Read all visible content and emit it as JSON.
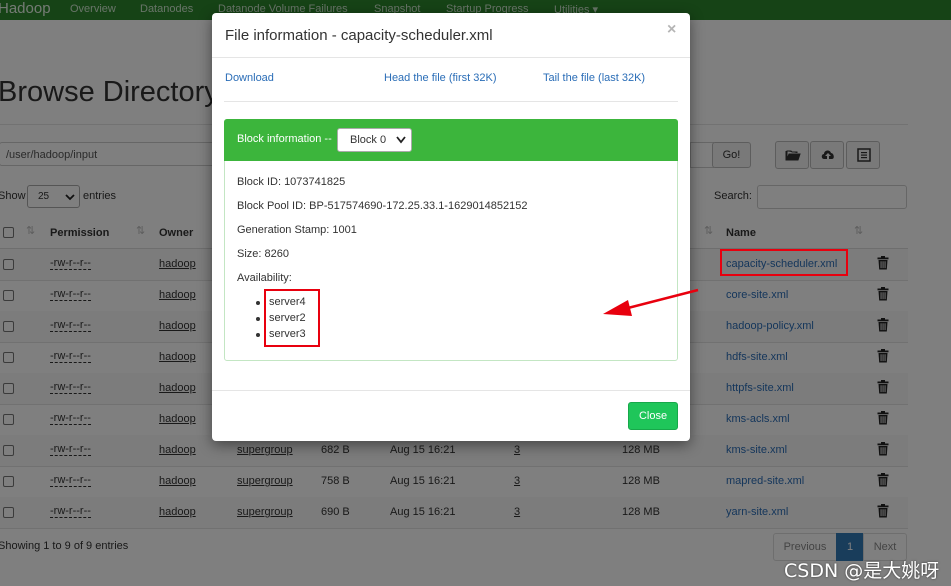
{
  "navbar": {
    "brand": "Hadoop",
    "items": [
      "Overview",
      "Datanodes",
      "Datanode Volume Failures",
      "Snapshot",
      "Startup Progress",
      "Utilities"
    ]
  },
  "page": {
    "title": "Browse Directory",
    "path_value": "/user/hadoop/input",
    "go_label": "Go!",
    "show_label": "Show",
    "entries_value": "25",
    "entries_label": "entries",
    "search_label": "Search:"
  },
  "table": {
    "headers": {
      "permission": "Permission",
      "owner": "Owner",
      "name": "Name"
    },
    "rows": [
      {
        "permission": "-rw-r--r--",
        "owner": "hadoop",
        "group": "",
        "size": "",
        "modified": "",
        "replication": "",
        "block_size": "",
        "name": "capacity-scheduler.xml"
      },
      {
        "permission": "-rw-r--r--",
        "owner": "hadoop",
        "group": "",
        "size": "",
        "modified": "",
        "replication": "",
        "block_size": "",
        "name": "core-site.xml"
      },
      {
        "permission": "-rw-r--r--",
        "owner": "hadoop",
        "group": "",
        "size": "",
        "modified": "",
        "replication": "",
        "block_size": "",
        "name": "hadoop-policy.xml"
      },
      {
        "permission": "-rw-r--r--",
        "owner": "hadoop",
        "group": "",
        "size": "",
        "modified": "",
        "replication": "",
        "block_size": "",
        "name": "hdfs-site.xml"
      },
      {
        "permission": "-rw-r--r--",
        "owner": "hadoop",
        "group": "",
        "size": "",
        "modified": "",
        "replication": "",
        "block_size": "",
        "name": "httpfs-site.xml"
      },
      {
        "permission": "-rw-r--r--",
        "owner": "hadoop",
        "group": "",
        "size": "",
        "modified": "",
        "replication": "",
        "block_size": "",
        "name": "kms-acls.xml"
      },
      {
        "permission": "-rw-r--r--",
        "owner": "hadoop",
        "group": "supergroup",
        "size": "682 B",
        "modified": "Aug 15 16:21",
        "replication": "3",
        "block_size": "128 MB",
        "name": "kms-site.xml"
      },
      {
        "permission": "-rw-r--r--",
        "owner": "hadoop",
        "group": "supergroup",
        "size": "758 B",
        "modified": "Aug 15 16:21",
        "replication": "3",
        "block_size": "128 MB",
        "name": "mapred-site.xml"
      },
      {
        "permission": "-rw-r--r--",
        "owner": "hadoop",
        "group": "supergroup",
        "size": "690 B",
        "modified": "Aug 15 16:21",
        "replication": "3",
        "block_size": "128 MB",
        "name": "yarn-site.xml"
      }
    ]
  },
  "footer": {
    "summary": "Showing 1 to 9 of 9 entries",
    "prev": "Previous",
    "current_page": "1",
    "next": "Next"
  },
  "modal": {
    "title": "File information - capacity-scheduler.xml",
    "close_glyph": "×",
    "links": {
      "download": "Download",
      "head": "Head the file (first 32K)",
      "tail": "Tail the file (last 32K)"
    },
    "block_label": "Block information --",
    "block_selected": "Block 0",
    "block_id": "Block ID: 1073741825",
    "block_pool_id": "Block Pool ID: BP-517574690-172.25.33.1-1629014852152",
    "generation_stamp": "Generation Stamp: 1001",
    "size": "Size: 8260",
    "availability_label": "Availability:",
    "servers": [
      "server4",
      "server2",
      "server3"
    ],
    "close_button": "Close"
  },
  "watermark": "CSDN @是大姚呀",
  "colors": {
    "navbar": "#2d862d",
    "panel_heading": "#3cb53c",
    "close_button": "#1fc65a",
    "link": "#2a6db7",
    "annotation": "#e8000e"
  },
  "icons": {
    "folder": "folder-open-icon",
    "upload": "cloud-upload-icon",
    "list": "list-alt-icon",
    "trash": "trash-icon"
  }
}
